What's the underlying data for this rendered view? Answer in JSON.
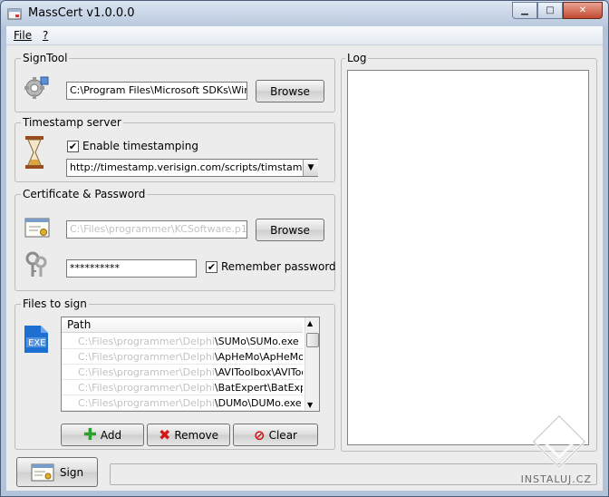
{
  "window": {
    "title": "MassCert v1.0.0.0"
  },
  "menu": {
    "file": "File",
    "help": "?"
  },
  "signtool": {
    "legend": "SignTool",
    "path": "C:\\Program Files\\Microsoft SDKs\\Windows",
    "browse_label": "Browse"
  },
  "timestamp": {
    "legend": "Timestamp server",
    "enable_label": "Enable timestamping",
    "enabled": true,
    "url": "http://timestamp.verisign.com/scripts/timstamp.dll"
  },
  "certificate": {
    "legend": "Certificate & Password",
    "path": "C:\\Files\\programmer\\KCSoftware.p12",
    "browse_label": "Browse",
    "password": "**********",
    "remember_label": "Remember password",
    "remember": true
  },
  "files": {
    "legend": "Files to sign",
    "column": "Path",
    "rows": [
      {
        "blurred": "C:\\Files\\programmer\\Delphi",
        "name": "\\SUMo\\SUMo.exe"
      },
      {
        "blurred": "C:\\Files\\programmer\\Delphi",
        "name": "\\ApHeMo\\ApHeMo.exe"
      },
      {
        "blurred": "C:\\Files\\programmer\\Delphi",
        "name": "\\AVIToolbox\\AVIToolbox"
      },
      {
        "blurred": "C:\\Files\\programmer\\Delphi",
        "name": "\\BatExpert\\BatExpert.exe"
      },
      {
        "blurred": "C:\\Files\\programmer\\Delphi",
        "name": "\\DUMo\\DUMo.exe"
      }
    ],
    "add_label": "Add",
    "remove_label": "Remove",
    "clear_label": "Clear"
  },
  "log": {
    "legend": "Log"
  },
  "sign_label": "Sign",
  "watermark": "INSTALUJ.CZ",
  "colors": {
    "add": "#2e9e2e",
    "remove": "#d01818",
    "clear": "#c81414",
    "exe_badge": "#1d6fd1"
  }
}
